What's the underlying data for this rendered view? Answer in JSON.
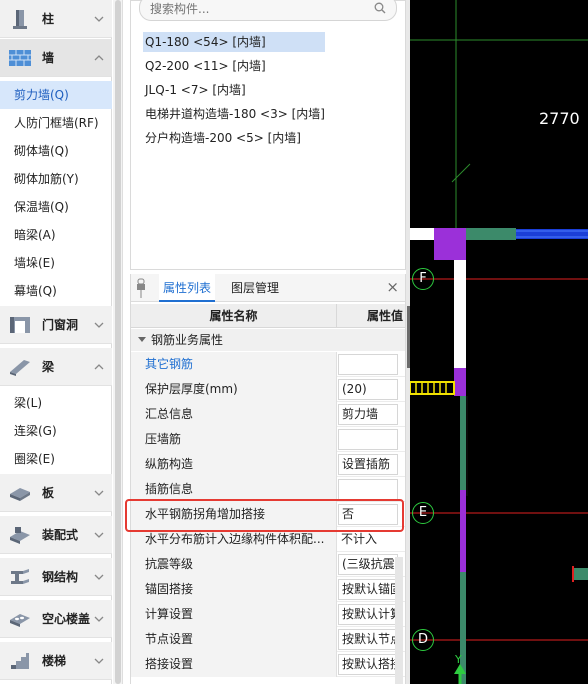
{
  "nav": {
    "categories": [
      {
        "label": "柱",
        "icon": "column-icon"
      },
      {
        "label": "墙",
        "icon": "wall-icon"
      },
      {
        "label": "门窗洞",
        "icon": "door-window-icon"
      },
      {
        "label": "梁",
        "icon": "beam-icon"
      },
      {
        "label": "板",
        "icon": "slab-icon"
      },
      {
        "label": "装配式",
        "icon": "prefab-icon"
      },
      {
        "label": "钢结构",
        "icon": "steel-icon"
      },
      {
        "label": "空心楼盖",
        "icon": "hollow-floor-icon"
      },
      {
        "label": "楼梯",
        "icon": "stair-icon"
      }
    ],
    "wall_items": [
      "剪力墙(Q)",
      "人防门框墙(RF)",
      "砌体墙(Q)",
      "砌体加筋(Y)",
      "保温墙(Q)",
      "暗梁(A)",
      "墙垛(E)",
      "幕墙(Q)"
    ],
    "beam_items": [
      "梁(L)",
      "连梁(G)",
      "圈梁(E)"
    ]
  },
  "search": {
    "placeholder": "搜索构件..."
  },
  "components": [
    "Q1-180 <54> [内墙]",
    "Q2-200 <11> [内墙]",
    "JLQ-1 <7> [内墙]",
    "电梯井道构造墙-180 <3> [内墙]",
    "分户构造墙-200 <5> [内墙]"
  ],
  "props": {
    "tab_list": "属性列表",
    "tab_layer": "图层管理",
    "col_name": "属性名称",
    "col_value": "属性值",
    "group": "钢筋业务属性",
    "rows": [
      {
        "name": "其它钢筋",
        "value": "",
        "link": true,
        "box": true
      },
      {
        "name": "保护层厚度(mm)",
        "value": "(20)",
        "link": false,
        "box": true
      },
      {
        "name": "汇总信息",
        "value": "剪力墙",
        "link": false,
        "box": true
      },
      {
        "name": "压墙筋",
        "value": "",
        "link": false,
        "box": true
      },
      {
        "name": "纵筋构造",
        "value": "设置插筋",
        "link": false,
        "box": true
      },
      {
        "name": "插筋信息",
        "value": "",
        "link": false,
        "box": true
      },
      {
        "name": "水平钢筋拐角增加搭接",
        "value": "否",
        "link": false,
        "box": true
      },
      {
        "name": "水平分布筋计入边缘构件体积配...",
        "value": "不计入",
        "link": false,
        "box": false
      },
      {
        "name": "抗震等级",
        "value": "(三级抗震)",
        "link": false,
        "box": true
      },
      {
        "name": "锚固搭接",
        "value": "按默认锚固",
        "link": false,
        "box": true
      },
      {
        "name": "计算设置",
        "value": "按默认计算",
        "link": false,
        "box": true
      },
      {
        "name": "节点设置",
        "value": "按默认节点",
        "link": false,
        "box": true
      },
      {
        "name": "搭接设置",
        "value": "按默认搭接",
        "link": false,
        "box": true
      }
    ]
  },
  "canvas": {
    "dimension": "2770",
    "axes": [
      "F",
      "E",
      "D"
    ],
    "y_marker": "Y"
  }
}
